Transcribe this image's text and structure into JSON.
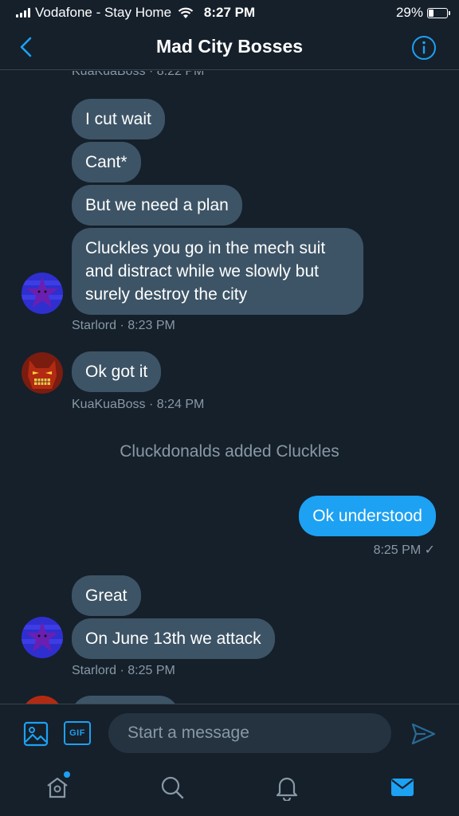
{
  "status_bar": {
    "carrier": "Vodafone - Stay Home",
    "time": "8:27 PM",
    "battery": "29%",
    "battery_level": 0.29
  },
  "header": {
    "title": "Mad City Bosses"
  },
  "messages": {
    "top_meta": "KuaKuaBoss · 8:22 PM",
    "m1": "I cut wait",
    "m2": "Cant*",
    "m3": "But we need a plan",
    "m4": "Cluckles you go in the mech suit and distract while we slowly but surely destroy the city",
    "meta1": "Starlord · 8:23 PM",
    "m5": "Ok got it",
    "meta2": "KuaKuaBoss · 8:24 PM",
    "system1": "Cluckdonalds added Cluckles",
    "m6": "Ok understood",
    "meta3": "8:25 PM ✓",
    "m7": "Great",
    "m8": "On June 13th we attack",
    "meta4": "Starlord · 8:25 PM"
  },
  "composer": {
    "gif_label": "GIF",
    "placeholder": "Start a message"
  },
  "colors": {
    "background": "#15202b",
    "incoming_bubble": "#3d5466",
    "outgoing_bubble": "#1da1f2",
    "accent": "#1da1f2",
    "muted_text": "#8899a6"
  },
  "icons": {
    "back": "chevron-left-icon",
    "info": "info-icon",
    "media": "image-icon",
    "send": "send-icon",
    "tabs": [
      "home-icon",
      "search-icon",
      "bell-icon",
      "mail-icon"
    ]
  }
}
